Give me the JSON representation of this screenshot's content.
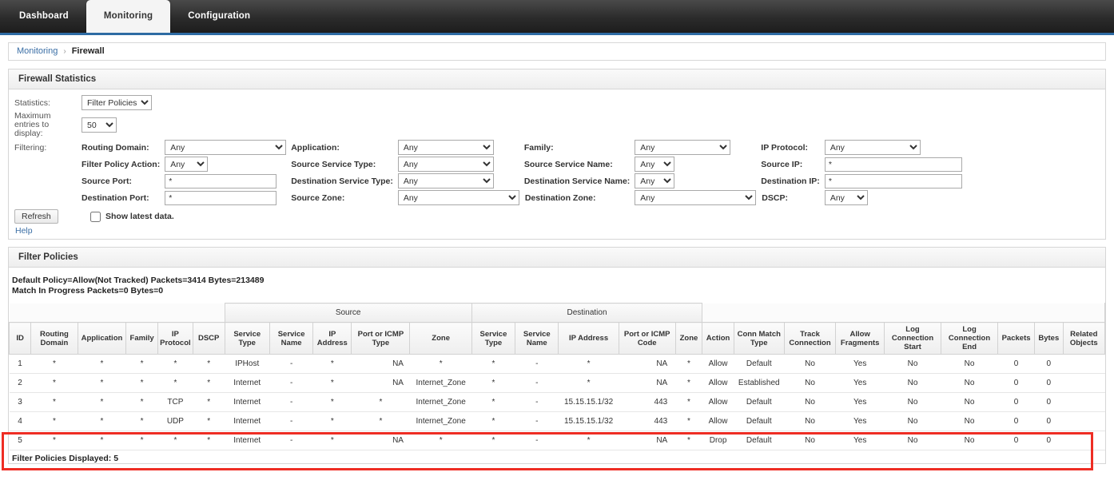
{
  "topnav": {
    "tabs": [
      {
        "label": "Dashboard",
        "active": false
      },
      {
        "label": "Monitoring",
        "active": true
      },
      {
        "label": "Configuration",
        "active": false
      }
    ]
  },
  "breadcrumb": {
    "parent": "Monitoring",
    "separator": "›",
    "current": "Firewall"
  },
  "stats_panel": {
    "title": "Firewall Statistics",
    "statistics_label": "Statistics:",
    "statistics_value": "Filter Policies",
    "max_entries_label": "Maximum entries to display:",
    "max_entries_value": "50",
    "filtering_label": "Filtering:",
    "fields": {
      "routing_domain": {
        "label": "Routing Domain:",
        "value": "Any"
      },
      "application": {
        "label": "Application:",
        "value": "Any"
      },
      "family": {
        "label": "Family:",
        "value": "Any"
      },
      "ip_protocol": {
        "label": "IP Protocol:",
        "value": "Any"
      },
      "filter_policy_action": {
        "label": "Filter Policy Action:",
        "value": "Any"
      },
      "source_service_type": {
        "label": "Source Service Type:",
        "value": "Any"
      },
      "source_service_name": {
        "label": "Source Service Name:",
        "value": "Any"
      },
      "source_ip": {
        "label": "Source IP:",
        "value": "*"
      },
      "source_port": {
        "label": "Source Port:",
        "value": "*"
      },
      "destination_service_type": {
        "label": "Destination Service Type:",
        "value": "Any"
      },
      "destination_service_name": {
        "label": "Destination Service Name:",
        "value": "Any"
      },
      "destination_ip": {
        "label": "Destination IP:",
        "value": "*"
      },
      "destination_port": {
        "label": "Destination Port:",
        "value": "*"
      },
      "source_zone": {
        "label": "Source Zone:",
        "value": "Any"
      },
      "destination_zone": {
        "label": "Destination Zone:",
        "value": "Any"
      },
      "dscp": {
        "label": "DSCP:",
        "value": "Any"
      }
    },
    "refresh_label": "Refresh",
    "show_latest_label": "Show latest data.",
    "help_label": "Help"
  },
  "policies_panel": {
    "title": "Filter Policies",
    "summary_line1": "Default Policy=Allow(Not Tracked) Packets=3414 Bytes=213489",
    "summary_line2": "Match In Progress Packets=0 Bytes=0",
    "group_headers": {
      "source": "Source",
      "destination": "Destination"
    },
    "columns": [
      "ID",
      "Routing Domain",
      "Application",
      "Family",
      "IP Protocol",
      "DSCP",
      "Service Type",
      "Service Name",
      "IP Address",
      "Port or ICMP Type",
      "Zone",
      "Service Type",
      "Service Name",
      "IP Address",
      "Port or ICMP Code",
      "Zone",
      "Action",
      "Conn Match Type",
      "Track Connection",
      "Allow Fragments",
      "Log Connection Start",
      "Log Connection End",
      "Packets",
      "Bytes",
      "Related Objects"
    ],
    "rows": [
      {
        "id": "1",
        "routing_domain": "*",
        "application": "*",
        "family": "*",
        "ip_protocol": "*",
        "dscp": "*",
        "src_service_type": "IPHost",
        "src_service_name": "-",
        "src_ip": "*",
        "src_port": "NA",
        "src_zone": "*",
        "dst_service_type": "*",
        "dst_service_name": "-",
        "dst_ip": "*",
        "dst_port": "NA",
        "dst_zone": "*",
        "action": "Allow",
        "conn_match_type": "Default",
        "track_connection": "No",
        "allow_fragments": "Yes",
        "log_start": "No",
        "log_end": "No",
        "packets": "0",
        "bytes": "0",
        "related_objects": "",
        "highlighted": false
      },
      {
        "id": "2",
        "routing_domain": "*",
        "application": "*",
        "family": "*",
        "ip_protocol": "*",
        "dscp": "*",
        "src_service_type": "Internet",
        "src_service_name": "-",
        "src_ip": "*",
        "src_port": "NA",
        "src_zone": "Internet_Zone",
        "dst_service_type": "*",
        "dst_service_name": "-",
        "dst_ip": "*",
        "dst_port": "NA",
        "dst_zone": "*",
        "action": "Allow",
        "conn_match_type": "Established",
        "track_connection": "No",
        "allow_fragments": "Yes",
        "log_start": "No",
        "log_end": "No",
        "packets": "0",
        "bytes": "0",
        "related_objects": "",
        "highlighted": false
      },
      {
        "id": "3",
        "routing_domain": "*",
        "application": "*",
        "family": "*",
        "ip_protocol": "TCP",
        "dscp": "*",
        "src_service_type": "Internet",
        "src_service_name": "-",
        "src_ip": "*",
        "src_port": "*",
        "src_zone": "Internet_Zone",
        "dst_service_type": "*",
        "dst_service_name": "-",
        "dst_ip": "15.15.15.1/32",
        "dst_port": "443",
        "dst_zone": "*",
        "action": "Allow",
        "conn_match_type": "Default",
        "track_connection": "No",
        "allow_fragments": "Yes",
        "log_start": "No",
        "log_end": "No",
        "packets": "0",
        "bytes": "0",
        "related_objects": "",
        "highlighted": true
      },
      {
        "id": "4",
        "routing_domain": "*",
        "application": "*",
        "family": "*",
        "ip_protocol": "UDP",
        "dscp": "*",
        "src_service_type": "Internet",
        "src_service_name": "-",
        "src_ip": "*",
        "src_port": "*",
        "src_zone": "Internet_Zone",
        "dst_service_type": "*",
        "dst_service_name": "-",
        "dst_ip": "15.15.15.1/32",
        "dst_port": "443",
        "dst_zone": "*",
        "action": "Allow",
        "conn_match_type": "Default",
        "track_connection": "No",
        "allow_fragments": "Yes",
        "log_start": "No",
        "log_end": "No",
        "packets": "0",
        "bytes": "0",
        "related_objects": "",
        "highlighted": true
      },
      {
        "id": "5",
        "routing_domain": "*",
        "application": "*",
        "family": "*",
        "ip_protocol": "*",
        "dscp": "*",
        "src_service_type": "Internet",
        "src_service_name": "-",
        "src_ip": "*",
        "src_port": "NA",
        "src_zone": "*",
        "dst_service_type": "*",
        "dst_service_name": "-",
        "dst_ip": "*",
        "dst_port": "NA",
        "dst_zone": "*",
        "action": "Drop",
        "conn_match_type": "Default",
        "track_connection": "No",
        "allow_fragments": "Yes",
        "log_start": "No",
        "log_end": "No",
        "packets": "0",
        "bytes": "0",
        "related_objects": "",
        "highlighted": false
      }
    ],
    "footnote": "Filter Policies Displayed: 5"
  },
  "colors": {
    "accent": "#2e6ca4",
    "annotation": "#ee2d24",
    "link": "#3a6ea5"
  }
}
